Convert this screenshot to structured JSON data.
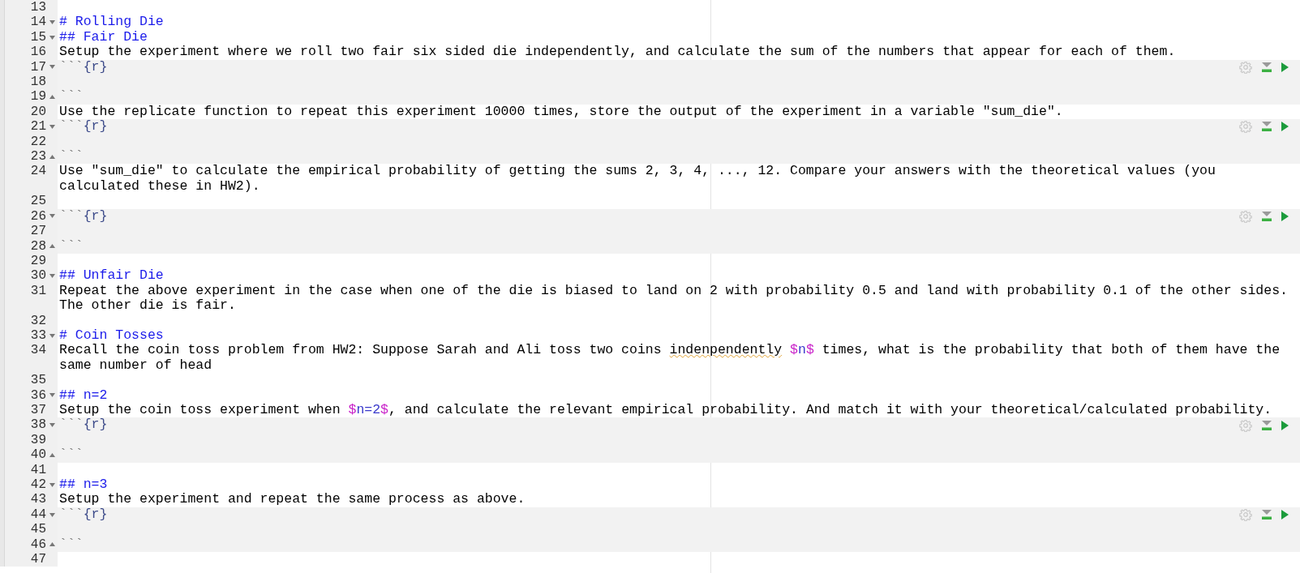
{
  "editor": {
    "lines": [
      {
        "number": "13",
        "fold_start": false,
        "fold_end": false,
        "kind": "blank"
      },
      {
        "number": "14",
        "fold_start": true,
        "fold_end": false,
        "kind": "heading",
        "segments": [
          {
            "text": "# Rolling Die",
            "kind": "text"
          }
        ]
      },
      {
        "number": "15",
        "fold_start": true,
        "fold_end": false,
        "kind": "heading",
        "segments": [
          {
            "text": "## Fair Die",
            "kind": "text"
          }
        ]
      },
      {
        "number": "16",
        "fold_start": false,
        "fold_end": false,
        "kind": "text",
        "segments": [
          {
            "text": "Setup the experiment where we roll two fair six sided die independently, and calculate the sum of the numbers that appear for each of them.",
            "kind": "text"
          }
        ]
      },
      {
        "number": "17",
        "fold_start": true,
        "fold_end": false,
        "kind": "chunk_start",
        "segments": [
          {
            "text": "```",
            "kind": "backtick"
          },
          {
            "text": "{r}",
            "kind": "chunk_label"
          }
        ]
      },
      {
        "number": "18",
        "fold_start": false,
        "fold_end": false,
        "kind": "chunk_body"
      },
      {
        "number": "19",
        "fold_start": false,
        "fold_end": true,
        "kind": "chunk_end",
        "segments": [
          {
            "text": "```",
            "kind": "backtick"
          }
        ]
      },
      {
        "number": "20",
        "fold_start": false,
        "fold_end": false,
        "kind": "text",
        "segments": [
          {
            "text": "Use the replicate function to repeat this experiment 10000 times, store the output of the experiment in a variable \"sum_die\".",
            "kind": "text"
          }
        ]
      },
      {
        "number": "21",
        "fold_start": true,
        "fold_end": false,
        "kind": "chunk_start",
        "segments": [
          {
            "text": "```",
            "kind": "backtick"
          },
          {
            "text": "{r}",
            "kind": "chunk_label"
          }
        ]
      },
      {
        "number": "22",
        "fold_start": false,
        "fold_end": false,
        "kind": "chunk_body"
      },
      {
        "number": "23",
        "fold_start": false,
        "fold_end": true,
        "kind": "chunk_end",
        "segments": [
          {
            "text": "```",
            "kind": "backtick"
          }
        ]
      },
      {
        "number": "24",
        "fold_start": false,
        "fold_end": false,
        "kind": "text",
        "segments": [
          {
            "text": "Use \"sum_die\" to calculate the empirical probability of getting the sums 2, 3, 4, ..., 12. Compare your answers with the theoretical values (you calculated these in HW2).",
            "kind": "text"
          }
        ]
      },
      {
        "number": "25",
        "fold_start": false,
        "fold_end": false,
        "kind": "blank"
      },
      {
        "number": "26",
        "fold_start": true,
        "fold_end": false,
        "kind": "chunk_start",
        "segments": [
          {
            "text": "```",
            "kind": "backtick"
          },
          {
            "text": "{r}",
            "kind": "chunk_label"
          }
        ]
      },
      {
        "number": "27",
        "fold_start": false,
        "fold_end": false,
        "kind": "chunk_body"
      },
      {
        "number": "28",
        "fold_start": false,
        "fold_end": true,
        "kind": "chunk_end",
        "segments": [
          {
            "text": "```",
            "kind": "backtick"
          }
        ]
      },
      {
        "number": "29",
        "fold_start": false,
        "fold_end": false,
        "kind": "blank"
      },
      {
        "number": "30",
        "fold_start": true,
        "fold_end": false,
        "kind": "heading",
        "segments": [
          {
            "text": "## Unfair Die",
            "kind": "text"
          }
        ]
      },
      {
        "number": "31",
        "fold_start": false,
        "fold_end": false,
        "kind": "text",
        "segments": [
          {
            "text": "Repeat the above experiment in the case when one of the die is biased to land on 2 with probability 0.5 and land with probability 0.1 of the other sides. The other die is fair.",
            "kind": "text"
          }
        ]
      },
      {
        "number": "32",
        "fold_start": false,
        "fold_end": false,
        "kind": "blank"
      },
      {
        "number": "33",
        "fold_start": true,
        "fold_end": false,
        "kind": "heading",
        "segments": [
          {
            "text": "# Coin Tosses",
            "kind": "text"
          }
        ]
      },
      {
        "number": "34",
        "fold_start": false,
        "fold_end": false,
        "kind": "text",
        "segments": [
          {
            "text": "Recall the coin toss problem from HW2: Suppose Sarah and Ali toss two coins ",
            "kind": "text"
          },
          {
            "text": "indenpendently",
            "kind": "misspelled"
          },
          {
            "text": " $",
            "kind": "math_delimiter"
          },
          {
            "text": "n",
            "kind": "math"
          },
          {
            "text": "$",
            "kind": "math_delimiter"
          },
          {
            "text": " times, what is the probability that both of them have the same number of head",
            "kind": "text"
          }
        ]
      },
      {
        "number": "35",
        "fold_start": false,
        "fold_end": false,
        "kind": "blank"
      },
      {
        "number": "36",
        "fold_start": true,
        "fold_end": false,
        "kind": "heading",
        "segments": [
          {
            "text": "## n=2",
            "kind": "text"
          }
        ]
      },
      {
        "number": "37",
        "fold_start": false,
        "fold_end": false,
        "kind": "text",
        "segments": [
          {
            "text": "Setup the coin toss experiment when ",
            "kind": "text"
          },
          {
            "text": "$",
            "kind": "math_delimiter"
          },
          {
            "text": "n=2",
            "kind": "math"
          },
          {
            "text": "$",
            "kind": "math_delimiter"
          },
          {
            "text": ", and calculate the relevant empirical probability. And match it with your theoretical/calculated probability.",
            "kind": "text"
          }
        ]
      },
      {
        "number": "38",
        "fold_start": true,
        "fold_end": false,
        "kind": "chunk_start",
        "segments": [
          {
            "text": "```",
            "kind": "backtick"
          },
          {
            "text": "{r}",
            "kind": "chunk_label"
          }
        ]
      },
      {
        "number": "39",
        "fold_start": false,
        "fold_end": false,
        "kind": "chunk_body"
      },
      {
        "number": "40",
        "fold_start": false,
        "fold_end": true,
        "kind": "chunk_end",
        "segments": [
          {
            "text": "```",
            "kind": "backtick"
          }
        ]
      },
      {
        "number": "41",
        "fold_start": false,
        "fold_end": false,
        "kind": "blank"
      },
      {
        "number": "42",
        "fold_start": true,
        "fold_end": false,
        "kind": "heading",
        "segments": [
          {
            "text": "## n=3",
            "kind": "text"
          }
        ]
      },
      {
        "number": "43",
        "fold_start": false,
        "fold_end": false,
        "kind": "text",
        "segments": [
          {
            "text": "Setup the experiment and repeat the same process as above.",
            "kind": "text"
          }
        ]
      },
      {
        "number": "44",
        "fold_start": true,
        "fold_end": false,
        "kind": "chunk_start",
        "segments": [
          {
            "text": "```",
            "kind": "backtick"
          },
          {
            "text": "{r}",
            "kind": "chunk_label"
          }
        ]
      },
      {
        "number": "45",
        "fold_start": false,
        "fold_end": false,
        "kind": "chunk_body"
      },
      {
        "number": "46",
        "fold_start": false,
        "fold_end": true,
        "kind": "chunk_end",
        "segments": [
          {
            "text": "```",
            "kind": "backtick"
          }
        ]
      },
      {
        "number": "47",
        "fold_start": false,
        "fold_end": false,
        "kind": "blank"
      }
    ]
  }
}
